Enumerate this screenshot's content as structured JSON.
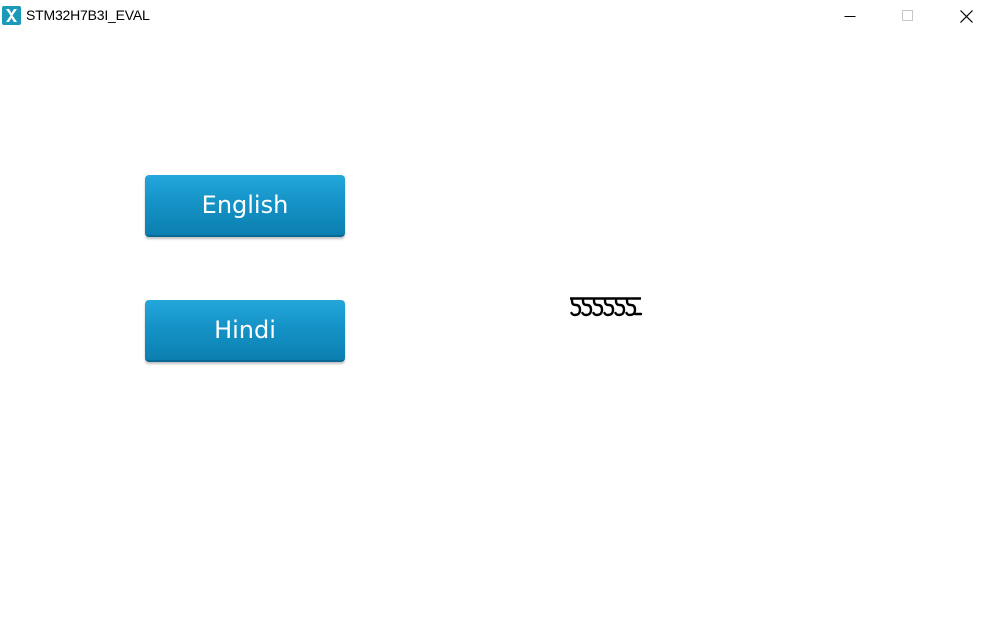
{
  "window": {
    "title": "STM32H7B3I_EVAL"
  },
  "titlebar": {
    "minimize_icon": "minimize-icon",
    "maximize_icon": "maximize-icon",
    "close_icon": "close-icon"
  },
  "buttons": {
    "english_label": "English",
    "hindi_label": "Hindi"
  },
  "display": {
    "glyph_text_icon": "unrendered-hindi-glyphs-icon"
  },
  "colors": {
    "button_top": "#24a7db",
    "button_bottom": "#0c7fb0",
    "app_icon": "#1a9ab8"
  }
}
